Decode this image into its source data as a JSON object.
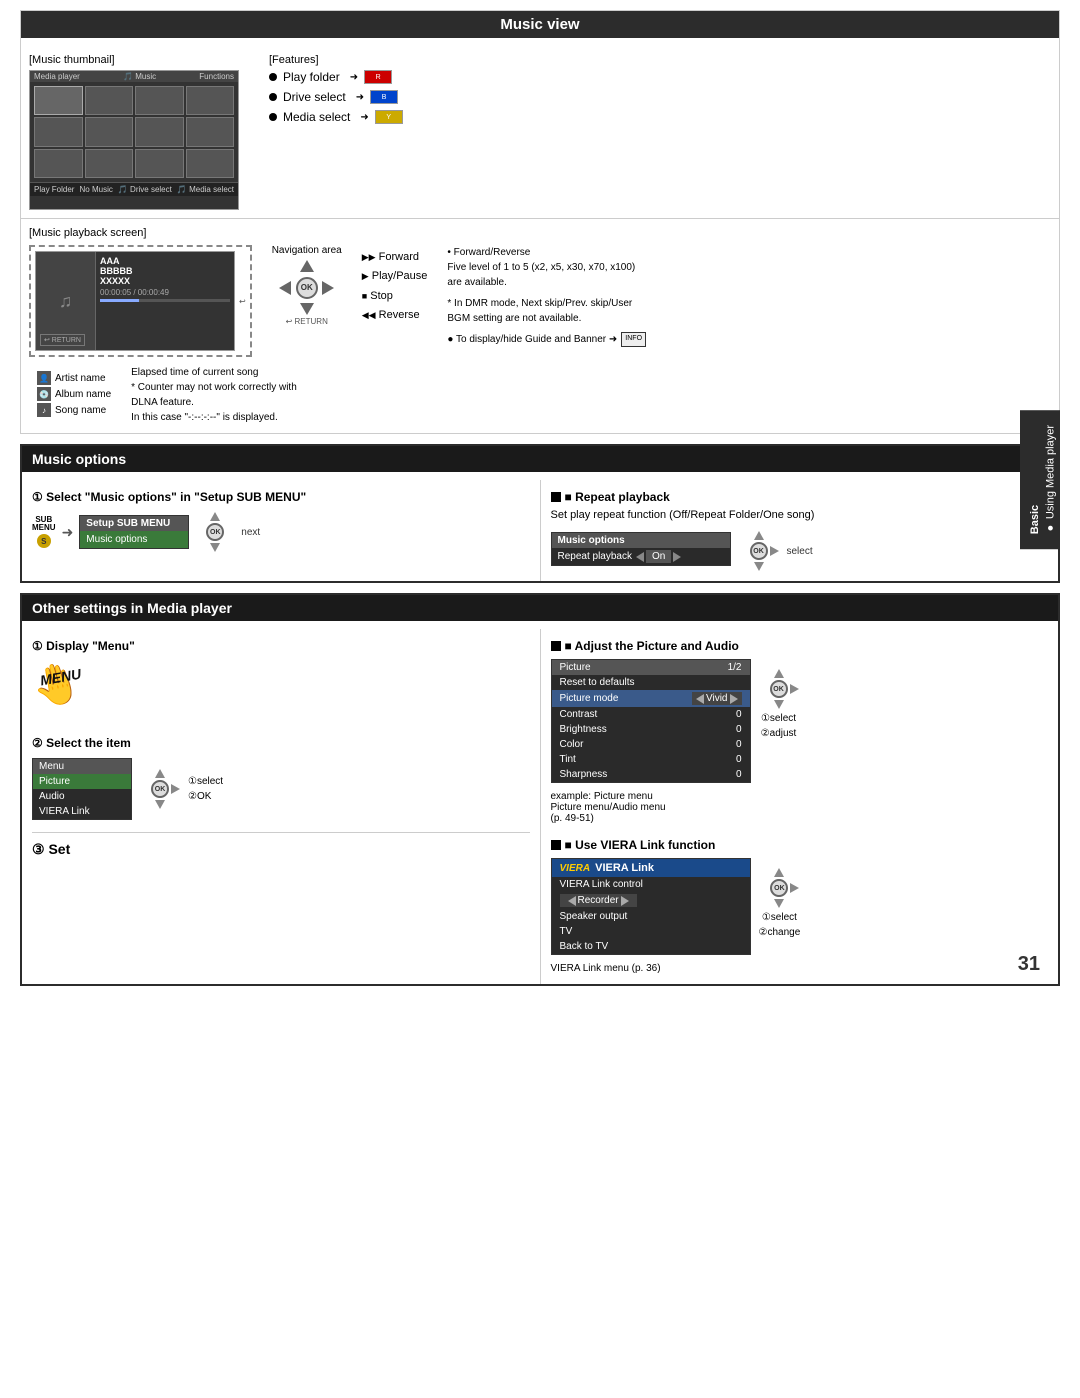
{
  "page": {
    "number": "31"
  },
  "sidebar": {
    "basic_label": "Basic",
    "using_label": "● Using Media player"
  },
  "music_view": {
    "title": "Music view",
    "thumbnail_label": "[Music thumbnail]",
    "features_label": "[Features]",
    "features": [
      {
        "label": "Play folder",
        "btn": "R",
        "btn_color": "red"
      },
      {
        "label": "Drive select",
        "btn": "B",
        "btn_color": "blue"
      },
      {
        "label": "Media select",
        "btn": "Y",
        "btn_color": "yellow"
      }
    ],
    "playback_screen_label": "[Music playback screen]",
    "navigation_area_label": "Navigation area",
    "forward_label": "Forward",
    "play_pause_label": "Play/Pause",
    "stop_label": "Stop",
    "reverse_label": "Reverse",
    "note1": "• Forward/Reverse",
    "note2": "Five level of 1 to 5 (x2, x5, x30, x70, x100)",
    "note3": "are available.",
    "note4": "* In DMR mode, Next skip/Prev. skip/User",
    "note5": "BGM setting are not available.",
    "guide_banner": "● To display/hide Guide and Banner ➜",
    "info_label": "INFO",
    "artist_label": "Artist name",
    "album_label": "Album name",
    "song_label": "Song name",
    "elapsed_label": "Elapsed time of current song",
    "elapsed_note": "* Counter may not work correctly with",
    "dlna_note": "DLNA feature.",
    "display_note": "In this case \"-:--:-:--\" is displayed.",
    "song_a": "AAA",
    "song_b": "BBBBB",
    "song_c": "XXXXX",
    "time_display": "00:00:05 / 00:00:49"
  },
  "music_options": {
    "title": "Music options",
    "step1_title": "① Select \"Music options\" in \"Setup SUB MENU\"",
    "sub_menu_label": "SUB",
    "menu_label": "MENU",
    "setup_sub_menu": "Setup SUB MENU",
    "music_options_item": "Music options",
    "next_label": "next",
    "repeat_title": "■ Repeat playback",
    "repeat_desc": "Set play repeat function (Off/Repeat Folder/One song)",
    "menu_header": "Music options",
    "repeat_row_label": "Repeat playback",
    "repeat_tri_left": "◄",
    "repeat_value": "On",
    "repeat_tri_right": "►",
    "select_label": "select"
  },
  "other_settings": {
    "title": "Other settings in Media player",
    "step1_title": "① Display \"Menu\"",
    "step2_title": "② Select the item",
    "step3_title": "③ Set",
    "menu_header": "Menu",
    "menu_items": [
      "Picture",
      "Audio",
      "VIERA Link"
    ],
    "select_1": "①select",
    "ok_2": "②OK",
    "adjust_title": "■ Adjust the Picture and Audio",
    "picture_header_label": "Picture",
    "picture_header_page": "1/2",
    "picture_rows": [
      {
        "label": "Reset to defaults",
        "value": ""
      },
      {
        "label": "Picture mode",
        "value": "Vivid",
        "has_arrows": true
      },
      {
        "label": "Contrast",
        "value": "0"
      },
      {
        "label": "Brightness",
        "value": "0"
      },
      {
        "label": "Color",
        "value": "0"
      },
      {
        "label": "Tint",
        "value": "0"
      },
      {
        "label": "Sharpness",
        "value": "0"
      }
    ],
    "example_label": "example: Picture menu",
    "picture_menu_note": "Picture menu/Audio menu",
    "page_ref": "(p. 49-51)",
    "viera_title": "■ Use VIERA Link function",
    "viera_header": "VIERA Link",
    "viera_rows": [
      {
        "label": "VIERA Link control",
        "value": ""
      },
      {
        "label": "Recorder",
        "has_arrows": true
      },
      {
        "label": "Speaker output",
        "value": ""
      },
      {
        "label": "TV",
        "value": ""
      },
      {
        "label": "Back to TV",
        "value": ""
      }
    ],
    "viera_menu_note": "VIERA Link menu (p. 36)",
    "select_1_label": "①select",
    "adjust_2_label": "②adjust",
    "select_viera_label": "①select",
    "change_2_label": "②change"
  }
}
